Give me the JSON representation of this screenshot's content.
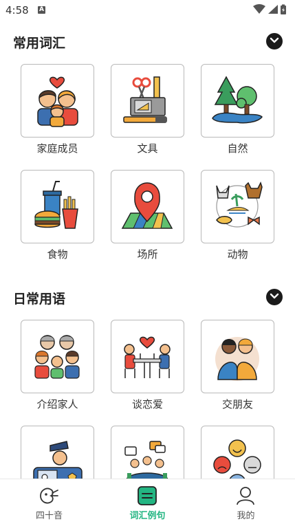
{
  "status_bar": {
    "time": "4:58",
    "notification_letter": "A"
  },
  "sections": [
    {
      "title": "常用词汇",
      "items": [
        {
          "label": "家庭成员",
          "icon": "family-icon"
        },
        {
          "label": "文具",
          "icon": "stationery-icon"
        },
        {
          "label": "自然",
          "icon": "nature-icon"
        },
        {
          "label": "食物",
          "icon": "food-icon"
        },
        {
          "label": "场所",
          "icon": "map-pin-icon"
        },
        {
          "label": "动物",
          "icon": "animals-icon"
        }
      ]
    },
    {
      "title": "日常用语",
      "items": [
        {
          "label": "介绍家人",
          "icon": "family-group-icon"
        },
        {
          "label": "谈恋爱",
          "icon": "couple-dinner-icon"
        },
        {
          "label": "交朋友",
          "icon": "friends-icon"
        },
        {
          "label": "",
          "icon": "police-icon"
        },
        {
          "label": "",
          "icon": "meeting-icon"
        },
        {
          "label": "",
          "icon": "emotions-icon"
        }
      ]
    }
  ],
  "bottom_nav": [
    {
      "label": "四十音",
      "icon": "kana-icon",
      "active": false
    },
    {
      "label": "词汇例句",
      "icon": "vocabulary-icon",
      "active": true
    },
    {
      "label": "我的",
      "icon": "profile-icon",
      "active": false
    }
  ],
  "colors": {
    "accent": "#23b582"
  }
}
